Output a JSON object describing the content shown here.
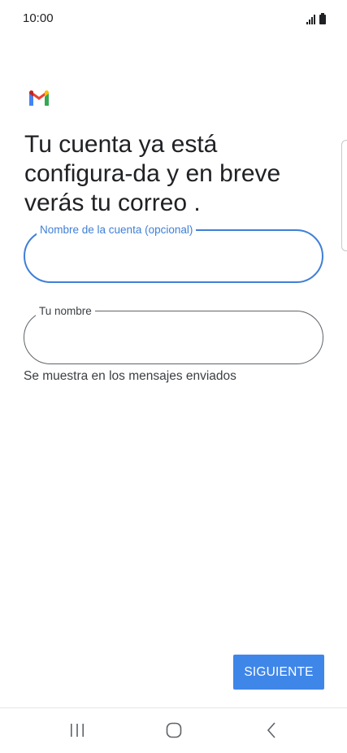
{
  "status_bar": {
    "time": "10:00"
  },
  "app": {
    "logo_icon": "gmail-logo-icon"
  },
  "main": {
    "headline": "Tu cuenta ya está configura-da y en breve verás tu correo .",
    "account_name_field": {
      "label": "Nombre de la cuenta (opcional)",
      "value": ""
    },
    "your_name_field": {
      "label": "Tu nombre",
      "value": ""
    },
    "helper_text": "Se muestra en los mensajes enviados",
    "next_button_label": "SIGUIENTE"
  },
  "nav_bar": {
    "recents_icon": "recents-icon",
    "home_icon": "home-icon",
    "back_icon": "back-icon"
  },
  "colors": {
    "accent": "#3f7fd6",
    "button": "#3f86e9"
  }
}
